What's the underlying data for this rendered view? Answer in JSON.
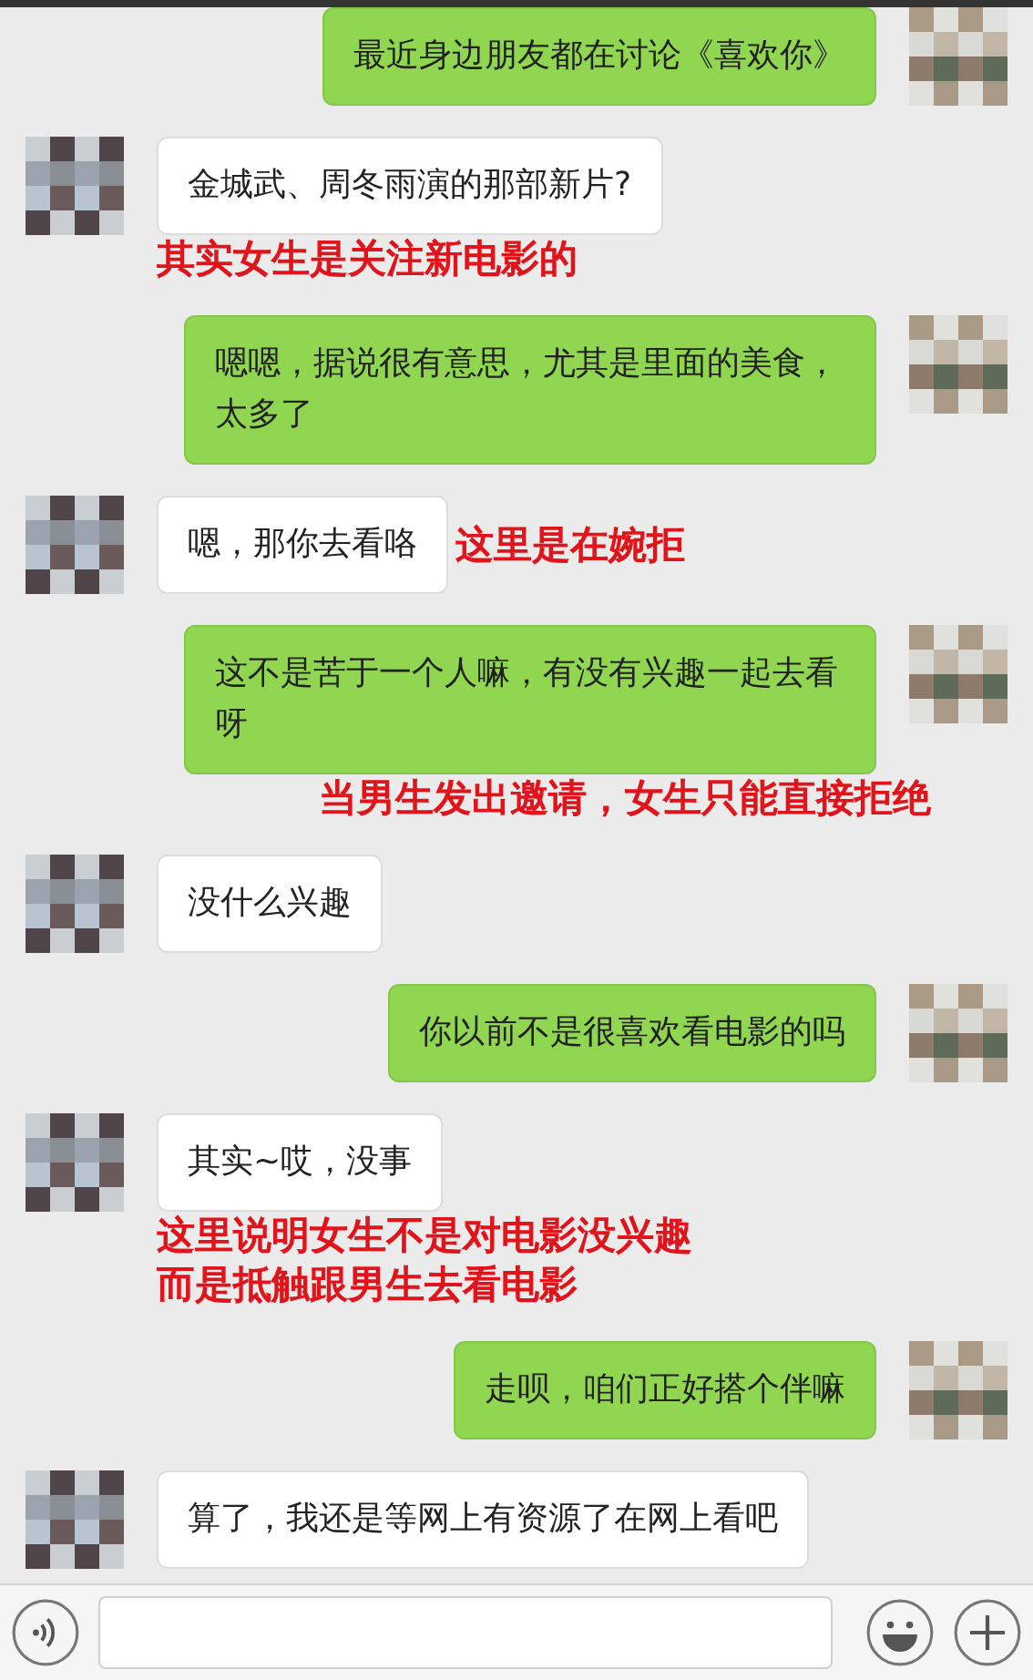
{
  "messages": [
    {
      "kind": "outgoing",
      "text": "最近身边朋友都在讨论《喜欢你》"
    },
    {
      "kind": "incoming",
      "text": "金城武、周冬雨演的那部新片?",
      "note": {
        "kind": "below",
        "lines": [
          "其实女生是关注新电影的"
        ]
      }
    },
    {
      "kind": "outgoing",
      "text": "嗯嗯，据说很有意思，尤其是里面的美食，太多了"
    },
    {
      "kind": "incoming",
      "text": "嗯，那你去看咯",
      "note": {
        "kind": "side",
        "lines": [
          "这里是在婉拒"
        ]
      }
    },
    {
      "kind": "outgoing",
      "text": "这不是苦于一个人嘛，有没有兴趣一起去看呀",
      "note": {
        "kind": "below",
        "lines": [
          "当男生发出邀请，女生只能直接拒绝"
        ]
      }
    },
    {
      "kind": "incoming",
      "text": "没什么兴趣"
    },
    {
      "kind": "outgoing",
      "text": "你以前不是很喜欢看电影的吗"
    },
    {
      "kind": "incoming",
      "text": "其实~哎，没事",
      "note": {
        "kind": "below",
        "lines": [
          "这里说明女生不是对电影没兴趣",
          "而是抵触跟男生去看电影"
        ]
      }
    },
    {
      "kind": "outgoing",
      "text": "走呗，咱们正好搭个伴嘛"
    },
    {
      "kind": "incoming",
      "text": "算了，我还是等网上有资源了在网上看吧"
    }
  ]
}
